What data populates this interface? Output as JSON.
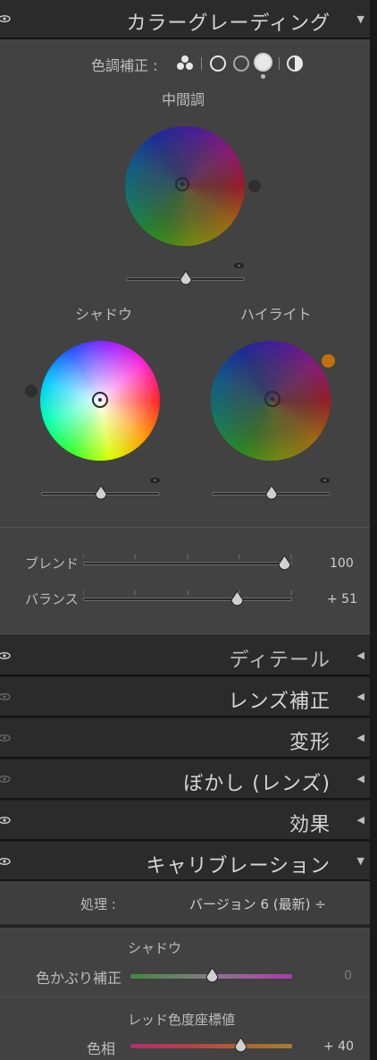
{
  "color_grading": {
    "title": "カラーグレーディング",
    "adjust_label": "色調補正 :",
    "midtones_label": "中間調",
    "shadows_label": "シャドウ",
    "highlights_label": "ハイライト",
    "blend_label": "ブレンド",
    "blend_value": "100",
    "balance_label": "バランス",
    "balance_value": "+ 51"
  },
  "sections": [
    {
      "title": "ディテール"
    },
    {
      "title": "レンズ補正"
    },
    {
      "title": "変形"
    },
    {
      "title": "ぼかし (レンズ)"
    },
    {
      "title": "効果"
    }
  ],
  "calibration": {
    "title": "キャリブレーション",
    "process_label": "処理 :",
    "process_value": "バージョン 6 (最新) ÷",
    "shadows_label": "シャドウ",
    "tint_label": "色かぶり補正",
    "tint_value": "0",
    "red_primary_label": "レッド色度座標値",
    "hue_label": "色相",
    "hue_value": "+ 40"
  },
  "colors": {
    "header_bg": "#2b2b2b",
    "panel_bg": "#424242",
    "highlight_dot": "#c2700e",
    "shadow_dot": "#2e2e2e"
  }
}
